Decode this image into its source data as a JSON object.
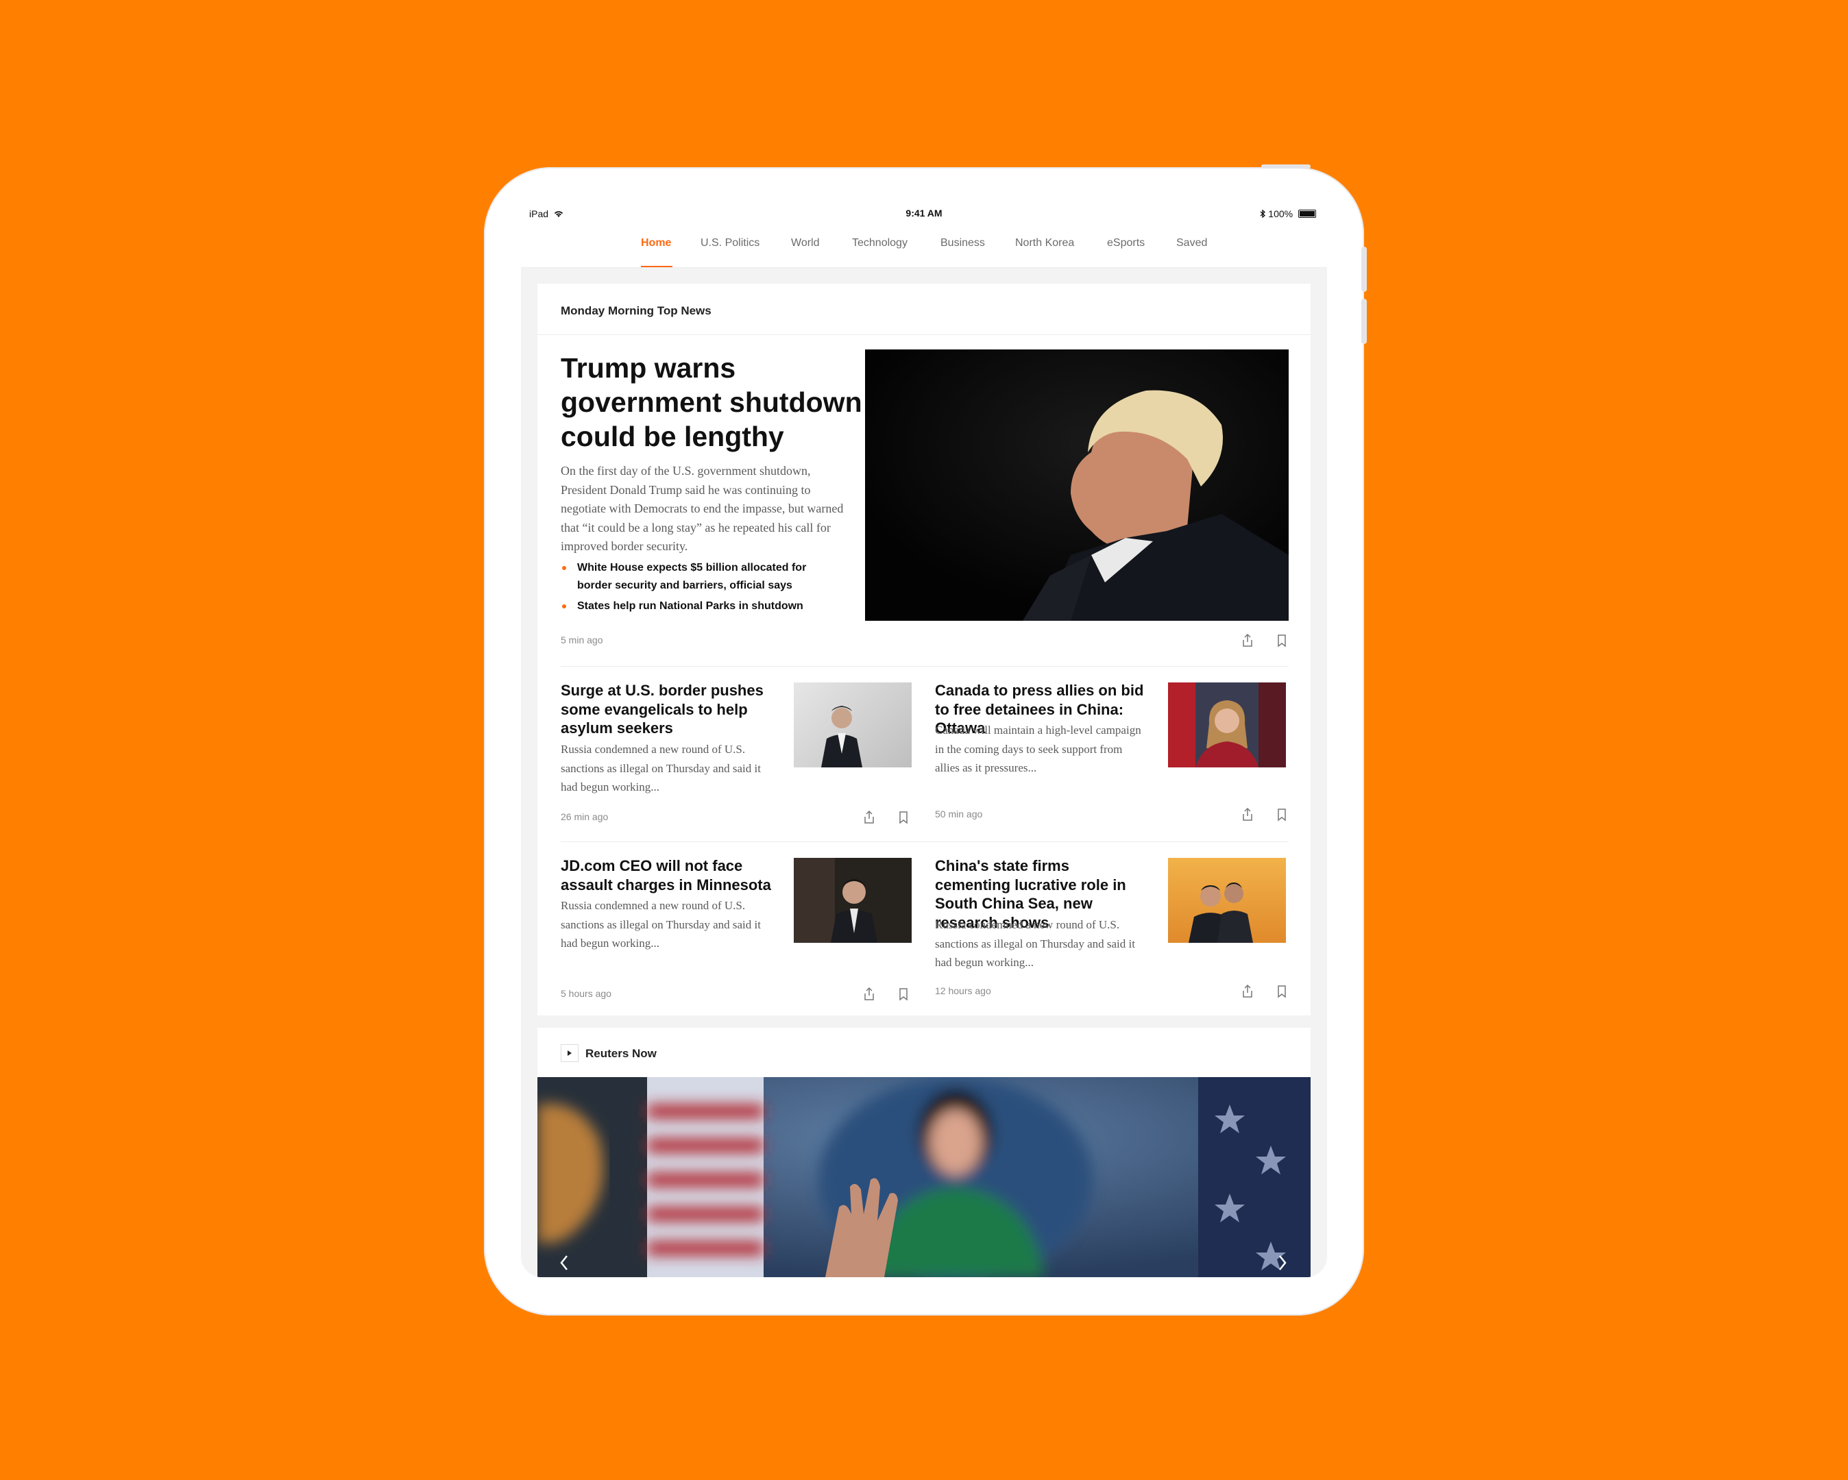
{
  "status_bar": {
    "device": "iPad",
    "time": "9:41 AM",
    "battery": "100%"
  },
  "nav": {
    "tabs": [
      "Home",
      "U.S. Politics",
      "World",
      "Technology",
      "Business",
      "North Korea",
      "eSports",
      "Saved"
    ],
    "active": "Home"
  },
  "top_news": {
    "header": "Monday Morning Top News",
    "lead": {
      "title": "Trump warns government shutdown could be lengthy",
      "summary": "On the first day of the U.S. government shutdown, President Donald Trump said he was continuing to negotiate with Democrats to end the impasse, but warned that “it could be a long stay” as he repeated his call for improved border security.",
      "bullets": [
        "White House expects $5 billion allocated for border security and barriers, official says",
        "States help run National Parks in shutdown"
      ],
      "time": "5 min ago"
    },
    "stories": [
      {
        "title": "Surge at U.S. border pushes some evangelicals to help asylum seekers",
        "summary": "Russia condemned a new round of U.S. sanctions as illegal on Thursday and said it had begun working...",
        "time": "26 min ago"
      },
      {
        "title": "Canada to press allies on bid to free detainees in China: Ottawa",
        "summary": "Canada will maintain a high-level campaign in the coming days to seek support from allies as it pressures...",
        "time": "50 min ago"
      },
      {
        "title": "JD.com CEO will not face assault charges in Minnesota",
        "summary": "Russia condemned a new round of U.S. sanctions as illegal on Thursday and said it had begun working...",
        "time": "5 hours ago"
      },
      {
        "title": "China's state firms cementing lucrative role in South China Sea, new research shows",
        "summary": "Russia condemned a new round of U.S. sanctions as illegal on Thursday and said it had begun working...",
        "time": "12 hours ago"
      }
    ]
  },
  "reuters_now": {
    "header": "Reuters Now"
  },
  "colors": {
    "background": "#FF8000",
    "accent": "#FF6A13"
  }
}
